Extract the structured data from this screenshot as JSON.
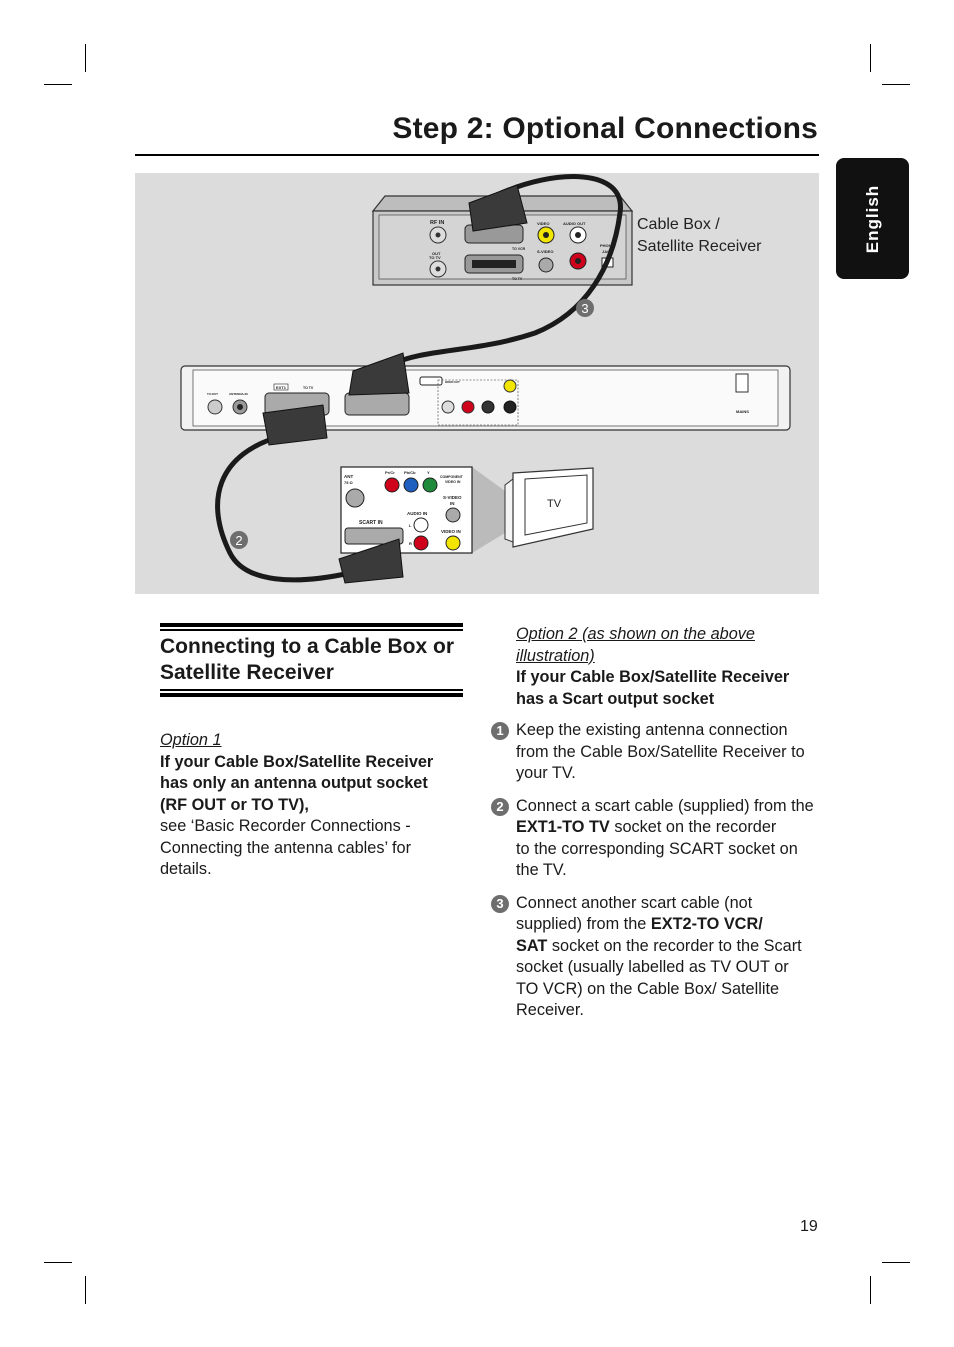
{
  "header": {
    "title": "Step 2: Optional Connections",
    "language_tab": "English"
  },
  "illustration": {
    "cable_box_label_line1": "Cable Box /",
    "cable_box_label_line2": "Satellite Receiver",
    "tv_label": "TV",
    "callouts": [
      "2",
      "3"
    ],
    "cable_box_panel": {
      "rf_in": "RF IN",
      "out_to_tv_1": "OUT",
      "out_to_tv_2": "TO TV",
      "video": "VIDEO",
      "audio_out": "AUDIO OUT",
      "s_video": "S-VIDEO",
      "to_vcr": "TO VCR",
      "to_tv": "TO TV",
      "phone_jack_1": "PHONE",
      "phone_jack_2": "JACK",
      "l": "L",
      "r": "R"
    },
    "recorder_panel": {
      "tv_out": "TV-OUT",
      "antenna_in": "ANTENNA-IN",
      "ext1": "EXT1",
      "to_tv": "TO TV",
      "hdmi_out": "HDMI OUT",
      "mains": "MAINS"
    },
    "tv_panel": {
      "ant": "ANT",
      "ant_ohm": "75 Ω",
      "pr": "Pr/Cr",
      "pb": "Pb/Cb",
      "y": "Y",
      "component_1": "COMPONENT",
      "component_2": "VIDEO IN",
      "svideo_1": "S-VIDEO",
      "svideo_2": "IN",
      "audio_in": "AUDIO IN",
      "l": "L",
      "r": "R",
      "scart_in": "SCART IN",
      "video_in": "VIDEO IN"
    },
    "colors": {
      "background": "#dcdcdc",
      "video_yellow": "#f2e600",
      "audio_red": "#d0021b",
      "pb_blue": "#1f5fc0",
      "y_green": "#1e8a3a",
      "cable": "#1a1a1a"
    }
  },
  "left": {
    "heading_line1": "Connecting to a Cable Box or",
    "heading_line2": "Satellite Receiver",
    "option_label": "Option 1",
    "bold_line1": "If your Cable Box/Satellite Receiver",
    "bold_line2": "has only an antenna output socket",
    "bold_line3": "(RF OUT or TO TV),",
    "text_line1": "see ‘Basic Recorder Connections -",
    "text_line2": "Connecting the antenna cables’ for",
    "text_line3": "details."
  },
  "right": {
    "option_label": "Option 2 (as shown on the above illustration)",
    "bold_line1": "If your Cable Box/Satellite Receiver",
    "bold_line2": "has a Scart output socket",
    "steps": [
      {
        "num": "1",
        "lines": [
          "Keep the existing antenna connection",
          "from the Cable Box/Satellite Receiver to",
          "your TV."
        ]
      },
      {
        "num": "2",
        "pre": "Connect a scart cable (supplied) from the",
        "bold": "EXT1-TO TV",
        "post1": " socket on the recorder",
        "post2": "to the corresponding SCART socket on",
        "post3": "the TV."
      },
      {
        "num": "3",
        "pre1": "Connect another scart cable (not",
        "pre2": "supplied) from the ",
        "bold1": "EXT2-TO VCR/",
        "bold2": "SAT",
        "post1": " socket on the recorder to the Scart",
        "post2": "socket (usually labelled as TV OUT or",
        "post3": "TO VCR) on the Cable Box/ Satellite",
        "post4": "Receiver."
      }
    ]
  },
  "footer": {
    "page_number": "19"
  }
}
